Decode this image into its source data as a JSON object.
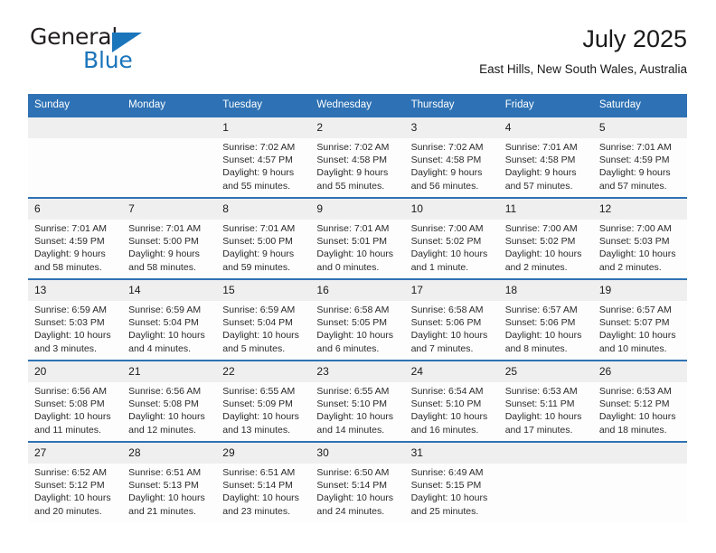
{
  "brand": {
    "name_part1": "General",
    "name_part2": "Blue",
    "triangle_icon": "brand-triangle-icon",
    "accent_color": "#1b75bb"
  },
  "header": {
    "title": "July 2025",
    "subtitle": "East Hills, New South Wales, Australia"
  },
  "theme": {
    "header_blue": "#2e72b5",
    "daynum_band": "#efefef",
    "cell_background": "#fdfdfd"
  },
  "calendar": {
    "weekday_headers": [
      "Sunday",
      "Monday",
      "Tuesday",
      "Wednesday",
      "Thursday",
      "Friday",
      "Saturday"
    ],
    "weeks": [
      [
        {
          "day": "",
          "empty": true,
          "sunrise": "",
          "sunset": "",
          "daylight_line1": "",
          "daylight_line2": ""
        },
        {
          "day": "",
          "empty": true,
          "sunrise": "",
          "sunset": "",
          "daylight_line1": "",
          "daylight_line2": ""
        },
        {
          "day": "1",
          "sunrise": "Sunrise: 7:02 AM",
          "sunset": "Sunset: 4:57 PM",
          "daylight_line1": "Daylight: 9 hours",
          "daylight_line2": "and 55 minutes."
        },
        {
          "day": "2",
          "sunrise": "Sunrise: 7:02 AM",
          "sunset": "Sunset: 4:58 PM",
          "daylight_line1": "Daylight: 9 hours",
          "daylight_line2": "and 55 minutes."
        },
        {
          "day": "3",
          "sunrise": "Sunrise: 7:02 AM",
          "sunset": "Sunset: 4:58 PM",
          "daylight_line1": "Daylight: 9 hours",
          "daylight_line2": "and 56 minutes."
        },
        {
          "day": "4",
          "sunrise": "Sunrise: 7:01 AM",
          "sunset": "Sunset: 4:58 PM",
          "daylight_line1": "Daylight: 9 hours",
          "daylight_line2": "and 57 minutes."
        },
        {
          "day": "5",
          "sunrise": "Sunrise: 7:01 AM",
          "sunset": "Sunset: 4:59 PM",
          "daylight_line1": "Daylight: 9 hours",
          "daylight_line2": "and 57 minutes."
        }
      ],
      [
        {
          "day": "6",
          "sunrise": "Sunrise: 7:01 AM",
          "sunset": "Sunset: 4:59 PM",
          "daylight_line1": "Daylight: 9 hours",
          "daylight_line2": "and 58 minutes."
        },
        {
          "day": "7",
          "sunrise": "Sunrise: 7:01 AM",
          "sunset": "Sunset: 5:00 PM",
          "daylight_line1": "Daylight: 9 hours",
          "daylight_line2": "and 58 minutes."
        },
        {
          "day": "8",
          "sunrise": "Sunrise: 7:01 AM",
          "sunset": "Sunset: 5:00 PM",
          "daylight_line1": "Daylight: 9 hours",
          "daylight_line2": "and 59 minutes."
        },
        {
          "day": "9",
          "sunrise": "Sunrise: 7:01 AM",
          "sunset": "Sunset: 5:01 PM",
          "daylight_line1": "Daylight: 10 hours",
          "daylight_line2": "and 0 minutes."
        },
        {
          "day": "10",
          "sunrise": "Sunrise: 7:00 AM",
          "sunset": "Sunset: 5:02 PM",
          "daylight_line1": "Daylight: 10 hours",
          "daylight_line2": "and 1 minute."
        },
        {
          "day": "11",
          "sunrise": "Sunrise: 7:00 AM",
          "sunset": "Sunset: 5:02 PM",
          "daylight_line1": "Daylight: 10 hours",
          "daylight_line2": "and 2 minutes."
        },
        {
          "day": "12",
          "sunrise": "Sunrise: 7:00 AM",
          "sunset": "Sunset: 5:03 PM",
          "daylight_line1": "Daylight: 10 hours",
          "daylight_line2": "and 2 minutes."
        }
      ],
      [
        {
          "day": "13",
          "sunrise": "Sunrise: 6:59 AM",
          "sunset": "Sunset: 5:03 PM",
          "daylight_line1": "Daylight: 10 hours",
          "daylight_line2": "and 3 minutes."
        },
        {
          "day": "14",
          "sunrise": "Sunrise: 6:59 AM",
          "sunset": "Sunset: 5:04 PM",
          "daylight_line1": "Daylight: 10 hours",
          "daylight_line2": "and 4 minutes."
        },
        {
          "day": "15",
          "sunrise": "Sunrise: 6:59 AM",
          "sunset": "Sunset: 5:04 PM",
          "daylight_line1": "Daylight: 10 hours",
          "daylight_line2": "and 5 minutes."
        },
        {
          "day": "16",
          "sunrise": "Sunrise: 6:58 AM",
          "sunset": "Sunset: 5:05 PM",
          "daylight_line1": "Daylight: 10 hours",
          "daylight_line2": "and 6 minutes."
        },
        {
          "day": "17",
          "sunrise": "Sunrise: 6:58 AM",
          "sunset": "Sunset: 5:06 PM",
          "daylight_line1": "Daylight: 10 hours",
          "daylight_line2": "and 7 minutes."
        },
        {
          "day": "18",
          "sunrise": "Sunrise: 6:57 AM",
          "sunset": "Sunset: 5:06 PM",
          "daylight_line1": "Daylight: 10 hours",
          "daylight_line2": "and 8 minutes."
        },
        {
          "day": "19",
          "sunrise": "Sunrise: 6:57 AM",
          "sunset": "Sunset: 5:07 PM",
          "daylight_line1": "Daylight: 10 hours",
          "daylight_line2": "and 10 minutes."
        }
      ],
      [
        {
          "day": "20",
          "sunrise": "Sunrise: 6:56 AM",
          "sunset": "Sunset: 5:08 PM",
          "daylight_line1": "Daylight: 10 hours",
          "daylight_line2": "and 11 minutes."
        },
        {
          "day": "21",
          "sunrise": "Sunrise: 6:56 AM",
          "sunset": "Sunset: 5:08 PM",
          "daylight_line1": "Daylight: 10 hours",
          "daylight_line2": "and 12 minutes."
        },
        {
          "day": "22",
          "sunrise": "Sunrise: 6:55 AM",
          "sunset": "Sunset: 5:09 PM",
          "daylight_line1": "Daylight: 10 hours",
          "daylight_line2": "and 13 minutes."
        },
        {
          "day": "23",
          "sunrise": "Sunrise: 6:55 AM",
          "sunset": "Sunset: 5:10 PM",
          "daylight_line1": "Daylight: 10 hours",
          "daylight_line2": "and 14 minutes."
        },
        {
          "day": "24",
          "sunrise": "Sunrise: 6:54 AM",
          "sunset": "Sunset: 5:10 PM",
          "daylight_line1": "Daylight: 10 hours",
          "daylight_line2": "and 16 minutes."
        },
        {
          "day": "25",
          "sunrise": "Sunrise: 6:53 AM",
          "sunset": "Sunset: 5:11 PM",
          "daylight_line1": "Daylight: 10 hours",
          "daylight_line2": "and 17 minutes."
        },
        {
          "day": "26",
          "sunrise": "Sunrise: 6:53 AM",
          "sunset": "Sunset: 5:12 PM",
          "daylight_line1": "Daylight: 10 hours",
          "daylight_line2": "and 18 minutes."
        }
      ],
      [
        {
          "day": "27",
          "sunrise": "Sunrise: 6:52 AM",
          "sunset": "Sunset: 5:12 PM",
          "daylight_line1": "Daylight: 10 hours",
          "daylight_line2": "and 20 minutes."
        },
        {
          "day": "28",
          "sunrise": "Sunrise: 6:51 AM",
          "sunset": "Sunset: 5:13 PM",
          "daylight_line1": "Daylight: 10 hours",
          "daylight_line2": "and 21 minutes."
        },
        {
          "day": "29",
          "sunrise": "Sunrise: 6:51 AM",
          "sunset": "Sunset: 5:14 PM",
          "daylight_line1": "Daylight: 10 hours",
          "daylight_line2": "and 23 minutes."
        },
        {
          "day": "30",
          "sunrise": "Sunrise: 6:50 AM",
          "sunset": "Sunset: 5:14 PM",
          "daylight_line1": "Daylight: 10 hours",
          "daylight_line2": "and 24 minutes."
        },
        {
          "day": "31",
          "sunrise": "Sunrise: 6:49 AM",
          "sunset": "Sunset: 5:15 PM",
          "daylight_line1": "Daylight: 10 hours",
          "daylight_line2": "and 25 minutes."
        },
        {
          "day": "",
          "empty": true,
          "sunrise": "",
          "sunset": "",
          "daylight_line1": "",
          "daylight_line2": ""
        },
        {
          "day": "",
          "empty": true,
          "sunrise": "",
          "sunset": "",
          "daylight_line1": "",
          "daylight_line2": ""
        }
      ]
    ]
  }
}
